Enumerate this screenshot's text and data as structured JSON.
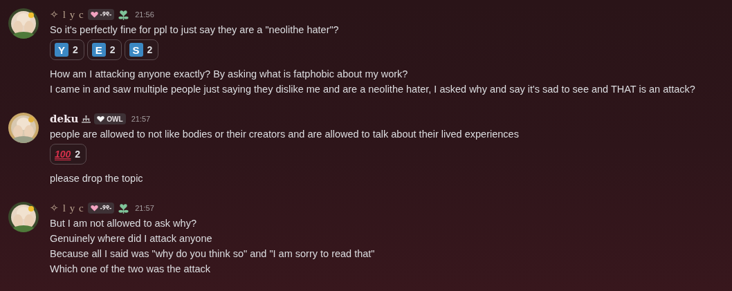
{
  "messages": [
    {
      "author": "✧ l y c",
      "kind": "serif",
      "role_tag": "-୨୧-",
      "flower_icon": true,
      "hierarchy_icon": false,
      "time": "21:56",
      "groups": [
        {
          "lines": [
            "So it's perfectly fine for ppl to just say they are a \"neolithe hater\"?"
          ],
          "reactions": [
            {
              "kind": "letter",
              "emoji": "Y",
              "count": "2"
            },
            {
              "kind": "letter",
              "emoji": "E",
              "count": "2"
            },
            {
              "kind": "letter",
              "emoji": "S",
              "count": "2"
            }
          ]
        },
        {
          "lines": [
            "How am I attacking anyone exactly? By asking what is fatphobic about my work?",
            "I came in and saw multiple people just saying they dislike me and are a neolithe hater, I asked why and say it's sad to see and THAT is an attack?"
          ]
        }
      ]
    },
    {
      "author": "deku",
      "kind": "bold",
      "role_tag": "OWL",
      "flower_icon": false,
      "hierarchy_icon": true,
      "time": "21:57",
      "groups": [
        {
          "lines": [
            "people are allowed to not like bodies or their creators and are allowed to talk about their lived experiences"
          ],
          "reactions": [
            {
              "kind": "hundred",
              "emoji": "100",
              "count": "2"
            }
          ]
        },
        {
          "lines": [
            "please drop the topic"
          ]
        }
      ]
    },
    {
      "author": "✧ l y c",
      "kind": "serif",
      "role_tag": "-୨୧-",
      "flower_icon": true,
      "hierarchy_icon": false,
      "time": "21:57",
      "groups": [
        {
          "lines": [
            "But I am not allowed to ask why?",
            "Genuinely where did I attack anyone",
            "Because all I said was \"why do you think so\" and \"I am sorry to read that\"",
            "Which one of the two was the attack"
          ]
        }
      ]
    }
  ]
}
